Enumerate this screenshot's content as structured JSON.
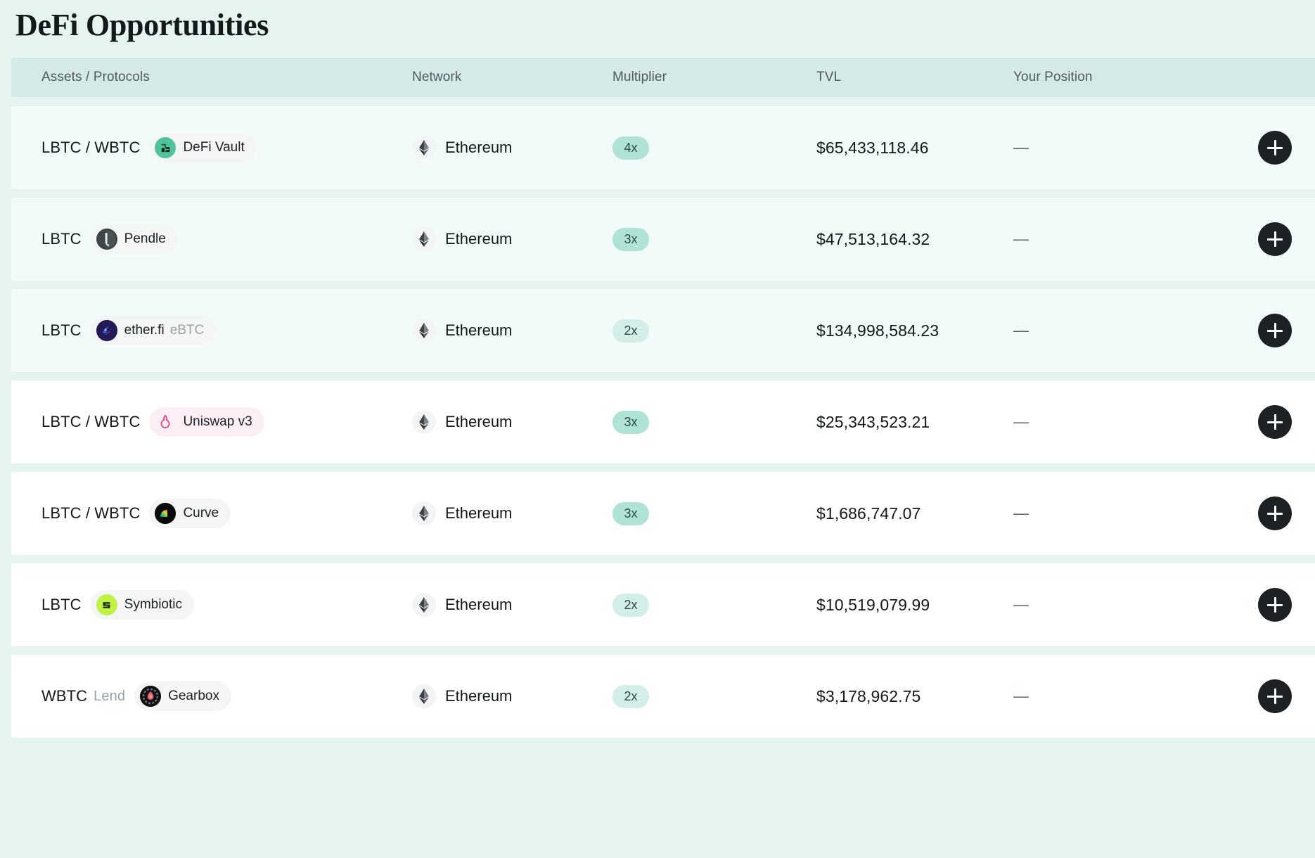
{
  "header": {
    "title": "DeFi Opportunities"
  },
  "table": {
    "columns": [
      {
        "key": "assets",
        "label": "Assets / Protocols"
      },
      {
        "key": "network",
        "label": "Network"
      },
      {
        "key": "mult",
        "label": "Multiplier"
      },
      {
        "key": "tvl",
        "label": "TVL"
      },
      {
        "key": "position",
        "label": "Your Position"
      }
    ],
    "action_label": "+",
    "action_icon": "plus-icon",
    "rows": [
      {
        "asset": "LBTC / WBTC",
        "asset_sub": "",
        "protocol": "DeFi Vault",
        "protocol_suffix": "",
        "protocol_icon": "defi-vault-icon",
        "network": "Ethereum",
        "network_icon": "ethereum-icon",
        "multiplier": "4x",
        "tvl": "$65,433,118.46",
        "position": "—",
        "tint": true,
        "badge_style": "grey",
        "pill_style": "strong"
      },
      {
        "asset": "LBTC",
        "asset_sub": "",
        "protocol": "Pendle",
        "protocol_suffix": "",
        "protocol_icon": "pendle-icon",
        "network": "Ethereum",
        "network_icon": "ethereum-icon",
        "multiplier": "3x",
        "tvl": "$47,513,164.32",
        "position": "—",
        "tint": true,
        "badge_style": "grey",
        "pill_style": "strong"
      },
      {
        "asset": "LBTC",
        "asset_sub": "",
        "protocol": "ether.fi",
        "protocol_suffix": "eBTC",
        "protocol_icon": "etherfi-icon",
        "network": "Ethereum",
        "network_icon": "ethereum-icon",
        "multiplier": "2x",
        "tvl": "$134,998,584.23",
        "position": "—",
        "tint": true,
        "badge_style": "grey",
        "pill_style": "soft"
      },
      {
        "asset": "LBTC / WBTC",
        "asset_sub": "",
        "protocol": "Uniswap v3",
        "protocol_suffix": "",
        "protocol_icon": "uniswap-icon",
        "network": "Ethereum",
        "network_icon": "ethereum-icon",
        "multiplier": "3x",
        "tvl": "$25,343,523.21",
        "position": "—",
        "tint": false,
        "badge_style": "pink",
        "pill_style": "strong"
      },
      {
        "asset": "LBTC / WBTC",
        "asset_sub": "",
        "protocol": "Curve",
        "protocol_suffix": "",
        "protocol_icon": "curve-icon",
        "network": "Ethereum",
        "network_icon": "ethereum-icon",
        "multiplier": "3x",
        "tvl": "$1,686,747.07",
        "position": "—",
        "tint": false,
        "badge_style": "grey",
        "pill_style": "strong"
      },
      {
        "asset": "LBTC",
        "asset_sub": "",
        "protocol": "Symbiotic",
        "protocol_suffix": "",
        "protocol_icon": "symbiotic-icon",
        "network": "Ethereum",
        "network_icon": "ethereum-icon",
        "multiplier": "2x",
        "tvl": "$10,519,079.99",
        "position": "—",
        "tint": false,
        "badge_style": "grey",
        "pill_style": "soft"
      },
      {
        "asset": "WBTC",
        "asset_sub": "Lend",
        "protocol": "Gearbox",
        "protocol_suffix": "",
        "protocol_icon": "gearbox-icon",
        "network": "Ethereum",
        "network_icon": "ethereum-icon",
        "multiplier": "2x",
        "tvl": "$3,178,962.75",
        "position": "—",
        "tint": false,
        "badge_style": "grey",
        "pill_style": "soft"
      }
    ]
  },
  "colors": {
    "page_bg": "#e6f4f1",
    "header_bg": "#d5eae6",
    "row_tint": "#f0fbfa",
    "row_plain": "#ffffff",
    "pill_strong": "#aee3d5",
    "pill_soft": "#d3eee9",
    "action_bg": "#1b2124"
  }
}
